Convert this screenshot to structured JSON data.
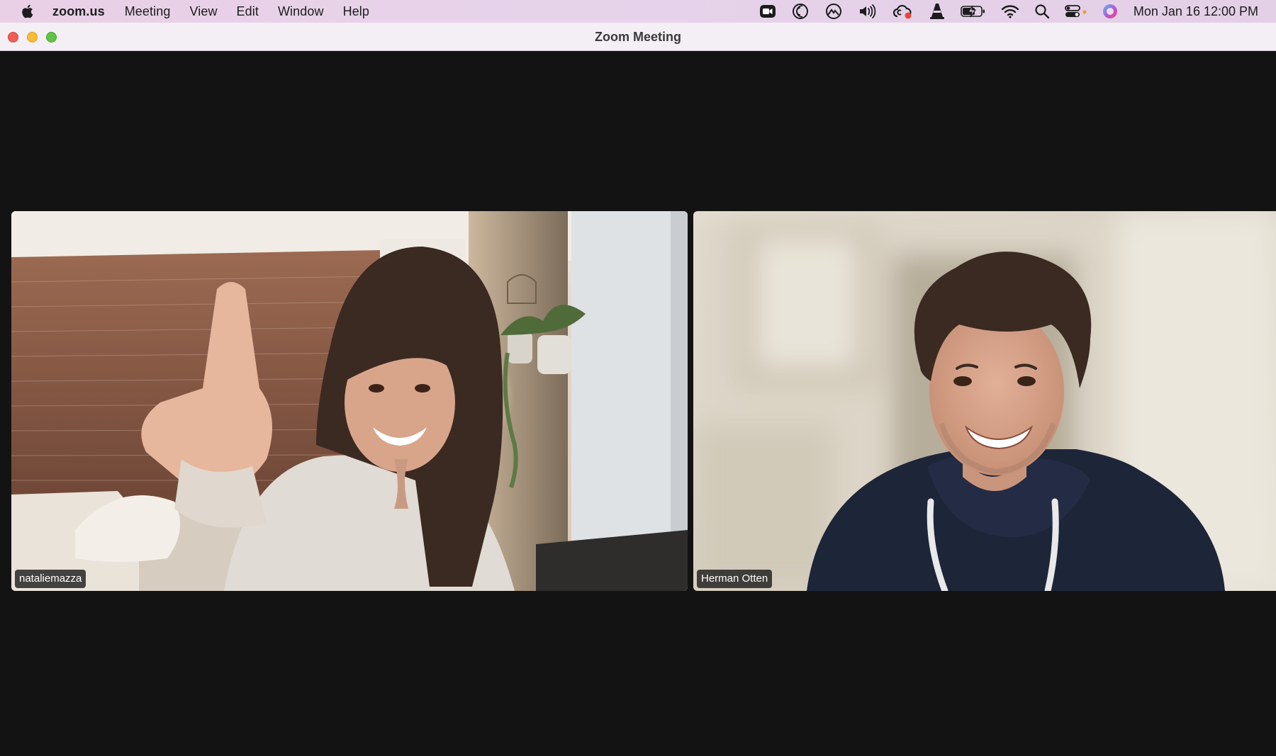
{
  "menubar": {
    "app_name": "zoom.us",
    "menus": [
      "Meeting",
      "View",
      "Edit",
      "Window",
      "Help"
    ],
    "status_icons": [
      "zoom-camera-icon",
      "crescent-icon",
      "mountain-icon",
      "speaker-icon",
      "creative-cloud-icon",
      "vlc-cone-icon",
      "battery-charging-icon",
      "wifi-icon",
      "spotlight-search-icon",
      "control-center-icon",
      "siri-icon"
    ],
    "clock": "Mon Jan 16  12:00 PM"
  },
  "window": {
    "title": "Zoom Meeting"
  },
  "participants": [
    {
      "name": "nataliemazza"
    },
    {
      "name": "Herman Otten"
    }
  ],
  "colors": {
    "stage_background": "#131313",
    "nameplate_background": "#1a1a1a",
    "menubar_tint": "#e7d1e7"
  }
}
